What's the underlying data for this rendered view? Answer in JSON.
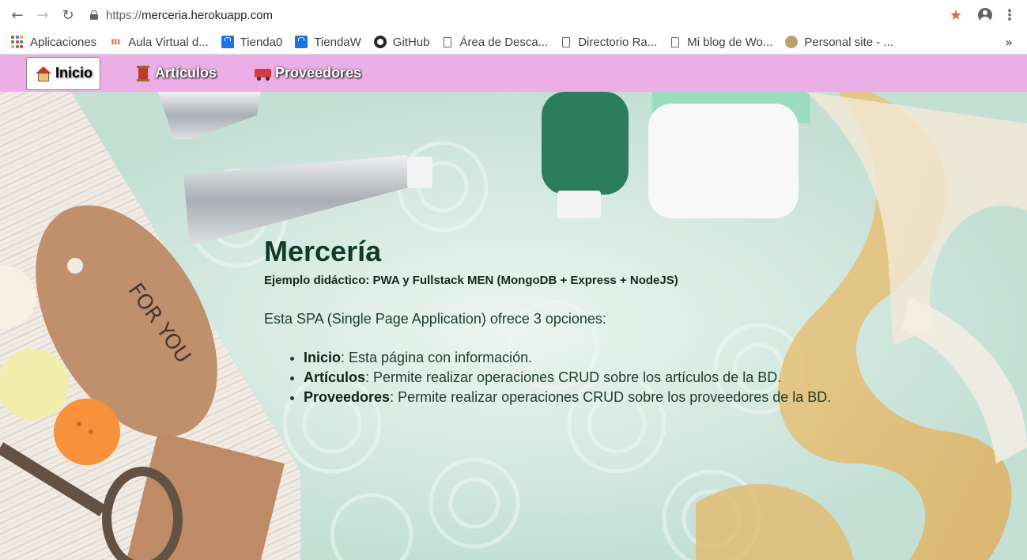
{
  "browser": {
    "url_scheme": "https://",
    "url_host": "merceria.herokuapp.com",
    "icons": [
      "back-arrow-icon",
      "forward-arrow-icon",
      "reload-icon",
      "lock-icon",
      "star-icon",
      "account-icon",
      "kebab-menu-icon"
    ],
    "star_color": "#e8643a"
  },
  "bookmarks": [
    {
      "label": "Aplicaciones",
      "icon": "apps-icon"
    },
    {
      "label": "Aula Virtual d...",
      "icon": "moodle-icon"
    },
    {
      "label": "Tienda0",
      "icon": "shopping-bag-icon"
    },
    {
      "label": "TiendaW",
      "icon": "shopping-bag-icon"
    },
    {
      "label": "GitHub",
      "icon": "github-icon"
    },
    {
      "label": "Área de Desca...",
      "icon": "page-icon"
    },
    {
      "label": "Directorio Ra...",
      "icon": "page-icon"
    },
    {
      "label": "Mi blog de Wo...",
      "icon": "page-icon"
    },
    {
      "label": "Personal site - ...",
      "icon": "site-icon"
    }
  ],
  "bookmarks_more": "»",
  "nav": {
    "background": "#ebaee6",
    "items": [
      {
        "label": "Inicio",
        "icon": "house-icon",
        "active": true
      },
      {
        "label": "Artículos",
        "icon": "spool-icon",
        "active": false
      },
      {
        "label": "Proveedores",
        "icon": "truck-icon",
        "active": false
      }
    ]
  },
  "main": {
    "title": "Mercería",
    "subtitle": "Ejemplo didáctico: PWA y Fullstack MEN (MongoDB + Express + NodeJS)",
    "intro": "Esta SPA (Single Page Application) ofrece 3 opciones:",
    "options": [
      {
        "name": "Inicio",
        "desc": ": Esta página con información."
      },
      {
        "name": "Artículos",
        "desc": ": Permite realizar operaciones CRUD sobre los artículos de la BD."
      },
      {
        "name": "Proveedores",
        "desc": ": Permite realizar operaciones CRUD sobre los proveedores de la BD."
      }
    ]
  }
}
